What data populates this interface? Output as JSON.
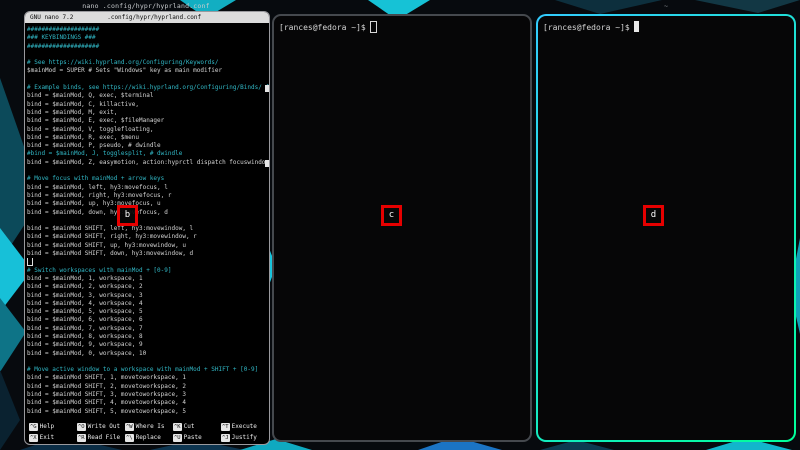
{
  "colors": {
    "active_border_start": "#33ccff",
    "active_border_end": "#00ff99",
    "inactive_border": "#45494e",
    "nano_border": "#9a9a9e",
    "comment": "#31b8c6",
    "hint_red": "#e60000",
    "wallpaper_base": "#070a0e",
    "wallpaper_teal": "#12aec2",
    "wallpaper_blue": "#1b74c4"
  },
  "nano": {
    "window_title": "nano .config/hypr/hyprland.conf",
    "version": "GNU nano 7.2",
    "filename": ".config/hypr/hyprland.conf",
    "hint_label": "b",
    "lines": [
      {
        "text": "####################",
        "kind": "comment"
      },
      {
        "text": "### KEYBINDINGS ###",
        "kind": "comment"
      },
      {
        "text": "####################",
        "kind": "comment"
      },
      {
        "text": "",
        "kind": "plain"
      },
      {
        "text": "# See https://wiki.hyprland.org/Configuring/Keywords/",
        "kind": "comment"
      },
      {
        "text": "$mainMod = SUPER # Sets \"Windows\" key as main modifier",
        "kind": "plain"
      },
      {
        "text": "",
        "kind": "plain"
      },
      {
        "text": "# Example binds, see https://wiki.hyprland.org/Configuring/Binds/ f",
        "kind": "comment",
        "overflow": true
      },
      {
        "text": "bind = $mainMod, Q, exec, $terminal",
        "kind": "plain"
      },
      {
        "text": "bind = $mainMod, C, killactive,",
        "kind": "plain"
      },
      {
        "text": "bind = $mainMod, M, exit,",
        "kind": "plain"
      },
      {
        "text": "bind = $mainMod, E, exec, $fileManager",
        "kind": "plain"
      },
      {
        "text": "bind = $mainMod, V, togglefloating,",
        "kind": "plain"
      },
      {
        "text": "bind = $mainMod, R, exec, $menu",
        "kind": "plain"
      },
      {
        "text": "bind = $mainMod, P, pseudo, # dwindle",
        "kind": "plain"
      },
      {
        "text": "#bind = $mainMod, J, togglesplit, # dwindle",
        "kind": "comment"
      },
      {
        "text": "bind = $mainMod, Z, easymotion, action:hyprctl dispatch focuswindow",
        "kind": "plain",
        "overflow": true
      },
      {
        "text": "",
        "kind": "plain"
      },
      {
        "text": "# Move focus with mainMod + arrow keys",
        "kind": "comment"
      },
      {
        "text": "bind = $mainMod, left, hy3:movefocus, l",
        "kind": "plain"
      },
      {
        "text": "bind = $mainMod, right, hy3:movefocus, r",
        "kind": "plain"
      },
      {
        "text": "bind = $mainMod, up, hy3:movefocus, u",
        "kind": "plain"
      },
      {
        "text": "bind = $mainMod, down, hy3:movefocus, d",
        "kind": "plain"
      },
      {
        "text": "",
        "kind": "plain"
      },
      {
        "text": "bind = $mainMod SHIFT, left, hy3:movewindow, l",
        "kind": "plain"
      },
      {
        "text": "bind = $mainMod SHIFT, right, hy3:movewindow, r",
        "kind": "plain"
      },
      {
        "text": "bind = $mainMod SHIFT, up, hy3:movewindow, u",
        "kind": "plain"
      },
      {
        "text": "bind = $mainMod SHIFT, down, hy3:movewindow, d",
        "kind": "plain"
      },
      {
        "text": "",
        "kind": "cursor"
      },
      {
        "text": "# Switch workspaces with mainMod + [0-9]",
        "kind": "comment"
      },
      {
        "text": "bind = $mainMod, 1, workspace, 1",
        "kind": "plain"
      },
      {
        "text": "bind = $mainMod, 2, workspace, 2",
        "kind": "plain"
      },
      {
        "text": "bind = $mainMod, 3, workspace, 3",
        "kind": "plain"
      },
      {
        "text": "bind = $mainMod, 4, workspace, 4",
        "kind": "plain"
      },
      {
        "text": "bind = $mainMod, 5, workspace, 5",
        "kind": "plain"
      },
      {
        "text": "bind = $mainMod, 6, workspace, 6",
        "kind": "plain"
      },
      {
        "text": "bind = $mainMod, 7, workspace, 7",
        "kind": "plain"
      },
      {
        "text": "bind = $mainMod, 8, workspace, 8",
        "kind": "plain"
      },
      {
        "text": "bind = $mainMod, 9, workspace, 9",
        "kind": "plain"
      },
      {
        "text": "bind = $mainMod, 0, workspace, 10",
        "kind": "plain"
      },
      {
        "text": "",
        "kind": "plain"
      },
      {
        "text": "# Move active window to a workspace with mainMod + SHIFT + [0-9]",
        "kind": "comment"
      },
      {
        "text": "bind = $mainMod SHIFT, 1, movetoworkspace, 1",
        "kind": "plain"
      },
      {
        "text": "bind = $mainMod SHIFT, 2, movetoworkspace, 2",
        "kind": "plain"
      },
      {
        "text": "bind = $mainMod SHIFT, 3, movetoworkspace, 3",
        "kind": "plain"
      },
      {
        "text": "bind = $mainMod SHIFT, 4, movetoworkspace, 4",
        "kind": "plain"
      },
      {
        "text": "bind = $mainMod SHIFT, 5, movetoworkspace, 5",
        "kind": "plain"
      }
    ],
    "shortcuts": [
      {
        "key": "^G",
        "label": "Help"
      },
      {
        "key": "^X",
        "label": "Exit"
      },
      {
        "key": "^O",
        "label": "Write Out"
      },
      {
        "key": "^R",
        "label": "Read File"
      },
      {
        "key": "^W",
        "label": "Where Is"
      },
      {
        "key": "^\\",
        "label": "Replace"
      },
      {
        "key": "^K",
        "label": "Cut"
      },
      {
        "key": "^U",
        "label": "Paste"
      },
      {
        "key": "^T",
        "label": "Execute"
      },
      {
        "key": "^J",
        "label": "Justify"
      }
    ]
  },
  "terminal_middle": {
    "prompt": "[rances@fedora ~]$",
    "hint_label": "c"
  },
  "terminal_right": {
    "window_title": "~",
    "prompt": "[rances@fedora ~]$",
    "hint_label": "d"
  }
}
